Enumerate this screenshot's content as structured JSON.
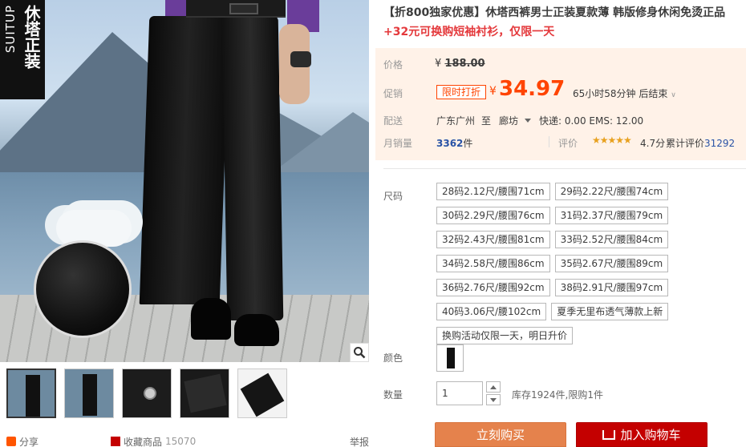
{
  "gallery": {
    "brand_cn": "休塔正装",
    "brand_en": "SUITUP",
    "share_label": "分享",
    "collect_label": "收藏商品",
    "collect_count": "15070",
    "report_label": "举报"
  },
  "product": {
    "title": "【折800独家优惠】休塔西裤男士正装夏款薄 韩版修身休闲免烫正品",
    "subtitle": "+32元可换购短袖衬衫，仅限一天"
  },
  "price": {
    "orig_label": "价格",
    "orig_yen": "¥",
    "orig_value": "188.00",
    "promo_label": "促销",
    "promo_badge": "限时打折",
    "promo_yen": "¥",
    "promo_value": "34.97",
    "countdown": "65小时58分钟 后结束",
    "ship_label": "配送",
    "ship_from": "广东广州",
    "ship_to": "至",
    "ship_city": "廊坊",
    "ship_fee": "快递: 0.00 EMS: 12.00",
    "sales_label": "月销量",
    "sales_value": "3362",
    "sales_unit": "件",
    "rating_label": "评价",
    "stars": "★★★★★",
    "rating_score": "4.7分",
    "review_label": "累计评价",
    "review_count": "31292"
  },
  "options": {
    "size_label": "尺码",
    "sizes": [
      "28码2.12尺/腰围71cm",
      "29码2.22尺/腰围74cm",
      "30码2.29尺/腰围76cm",
      "31码2.37尺/腰围79cm",
      "32码2.43尺/腰围81cm",
      "33码2.52尺/腰围84cm",
      "34码2.58尺/腰围86cm",
      "35码2.67尺/腰围89cm",
      "36码2.76尺/腰围92cm",
      "38码2.91尺/腰围97cm",
      "40码3.06尺/腰102cm",
      "夏季无里布透气薄款上新",
      "换购活动仅限一天，明日升价"
    ],
    "color_label": "颜色",
    "qty_label": "数量",
    "qty_value": "1",
    "stock": "库存1924件,限购1件"
  },
  "actions": {
    "buy_now": "立刻购买",
    "add_cart": "加入购物车"
  },
  "colors": {
    "accent": "#ff4400",
    "cart": "#c40000",
    "buy": "#e5824c"
  }
}
